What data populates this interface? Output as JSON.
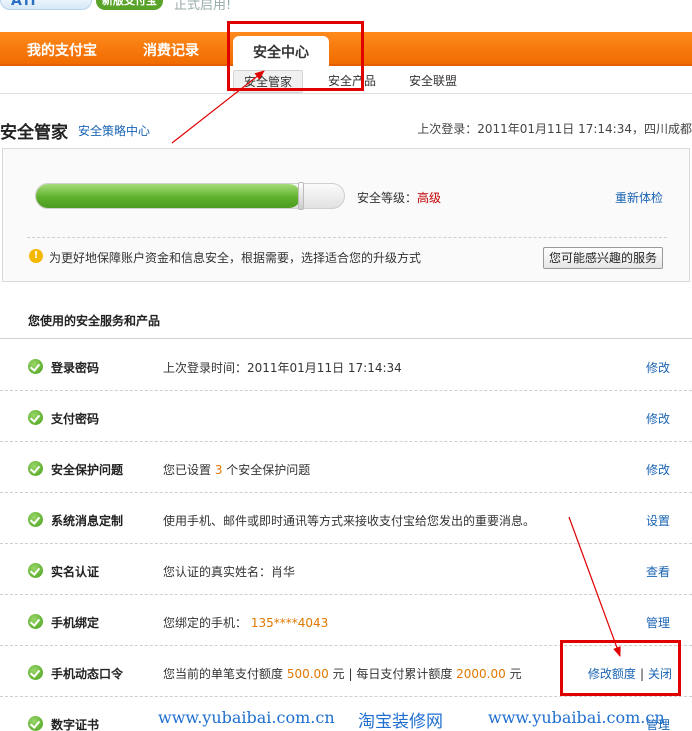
{
  "brand": {
    "logo_text": "Ali",
    "new_badge": "新版支付宝",
    "official_text": "正式启用!"
  },
  "nav": {
    "items": [
      "我的支付宝",
      "消费记录",
      "安全中心"
    ],
    "active_index": 2
  },
  "subnav": {
    "items": [
      "安全管家",
      "安全产品",
      "安全联盟"
    ],
    "active_index": 0
  },
  "header": {
    "title": "安全管家",
    "strategy_link": "安全策略中心",
    "last_login": "上次登录：2011年01月11日 17:14:34，四川成都"
  },
  "security_panel": {
    "level_label": "安全等级：",
    "level_value": "高级",
    "level_fraction": 0.86,
    "recheck_label": "重新体检",
    "tip_icon": "!",
    "tip_text": "为更好地保障账户资金和信息安全，根据需要，选择适合您的升级方式",
    "interest_button": "您可能感兴趣的服务"
  },
  "services": {
    "heading": "您使用的安全服务和产品",
    "rows": [
      {
        "name": "登录密码",
        "desc_pre": "上次登录时间：2011年01月11日 17:14:34",
        "desc_hl": "",
        "desc_post": "",
        "action": "修改"
      },
      {
        "name": "支付密码",
        "desc_pre": "",
        "desc_hl": "",
        "desc_post": "",
        "action": "修改"
      },
      {
        "name": "安全保护问题",
        "desc_pre": "您已设置 ",
        "desc_hl": "3",
        "desc_post": " 个安全保护问题",
        "action": "修改"
      },
      {
        "name": "系统消息定制",
        "desc_pre": "使用手机、邮件或即时通讯等方式来接收支付宝给您发出的重要消息。",
        "desc_hl": "",
        "desc_post": "",
        "action": "设置"
      },
      {
        "name": "实名认证",
        "desc_pre": "您认证的真实姓名：肖华",
        "desc_hl": "",
        "desc_post": "",
        "action": "查看"
      },
      {
        "name": "手机绑定",
        "desc_pre": "您绑定的手机： ",
        "desc_hl": "135****4043",
        "desc_post": "",
        "action": "管理"
      }
    ],
    "otp_row": {
      "name": "手机动态口令",
      "desc_pre": "您当前的单笔支付额度 ",
      "amount_single": "500.00",
      "desc_mid": " 元  | 每日支付累计额度 ",
      "amount_daily": "2000.00",
      "desc_post": " 元",
      "action_modify": "修改额度",
      "action_sep": "|",
      "action_close": "关闭"
    },
    "cert_row": {
      "name": "数字证书",
      "action": "管理"
    }
  },
  "watermark": {
    "url_left": "www.yubaibai.com.cn",
    "shop_name": "淘宝装修网",
    "url_right": "www.yubaibai.com.cn"
  }
}
